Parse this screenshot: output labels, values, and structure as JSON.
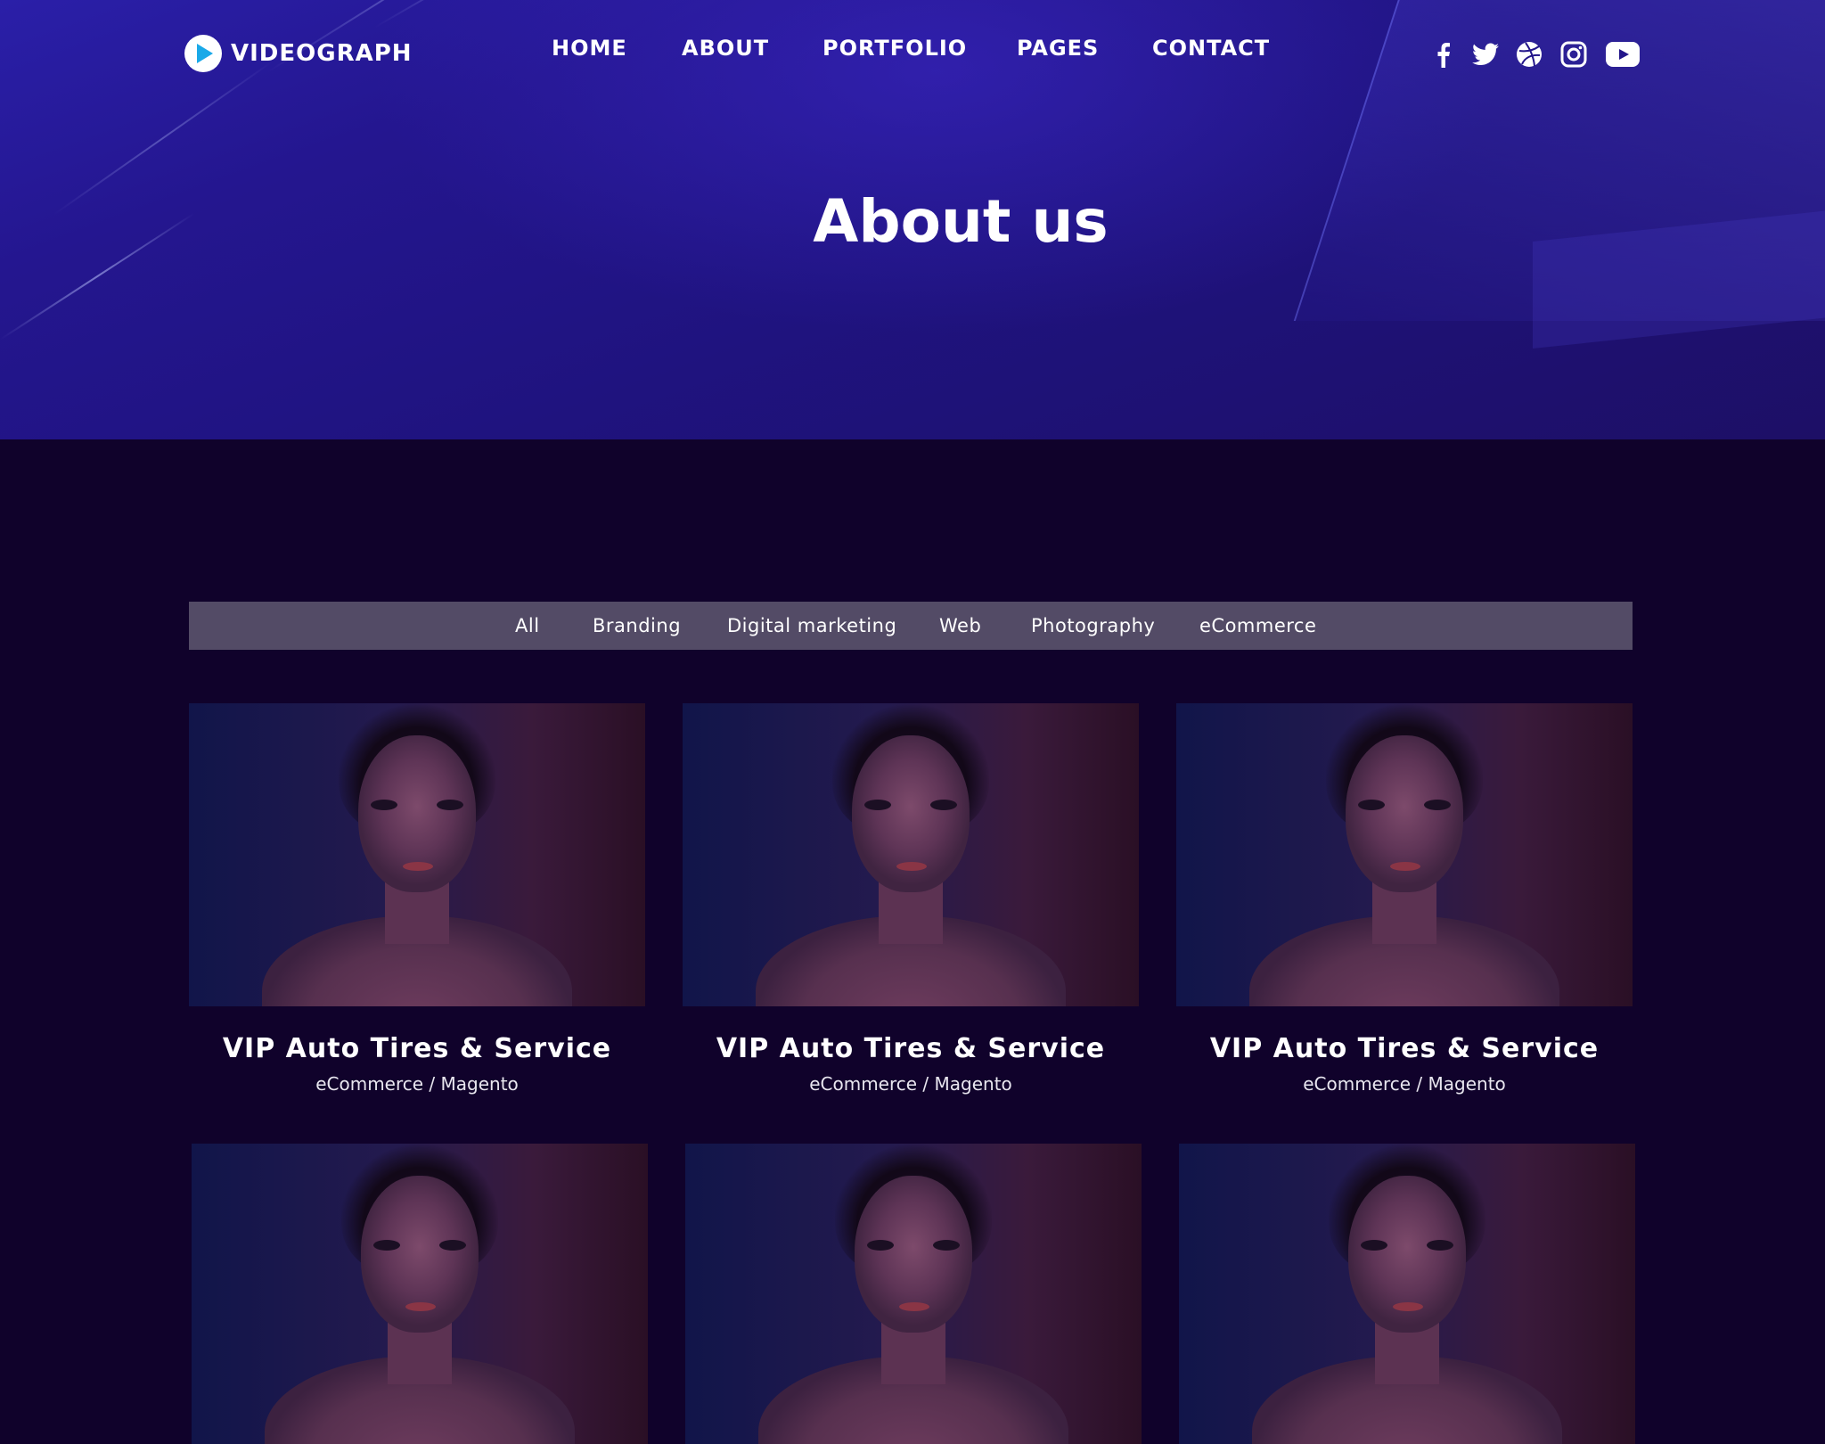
{
  "brand": {
    "name": "VIDEOGRAPH"
  },
  "nav": {
    "items": [
      "HOME",
      "ABOUT",
      "PORTFOLIO",
      "PAGES",
      "CONTACT"
    ]
  },
  "socials": [
    "facebook-icon",
    "twitter-icon",
    "dribbble-icon",
    "instagram-icon",
    "youtube-icon"
  ],
  "hero": {
    "title": "About us"
  },
  "filters": [
    "All",
    "Branding",
    "Digital marketing",
    "Web",
    "Photography",
    "eCommerce"
  ],
  "portfolio": [
    {
      "title": "VIP Auto Tires & Service",
      "subtitle": "eCommerce / Magento"
    },
    {
      "title": "VIP Auto Tires & Service",
      "subtitle": "eCommerce / Magento"
    },
    {
      "title": "VIP Auto Tires & Service",
      "subtitle": "eCommerce / Magento"
    },
    {
      "title": "",
      "subtitle": ""
    },
    {
      "title": "",
      "subtitle": ""
    },
    {
      "title": "",
      "subtitle": ""
    }
  ],
  "colors": {
    "hero_top": "#2a1fa8",
    "hero_bottom": "#1d0f66",
    "page_bg": "#10022b",
    "filter_bar": "#534b66",
    "logo_accent": "#1aa9e8"
  }
}
